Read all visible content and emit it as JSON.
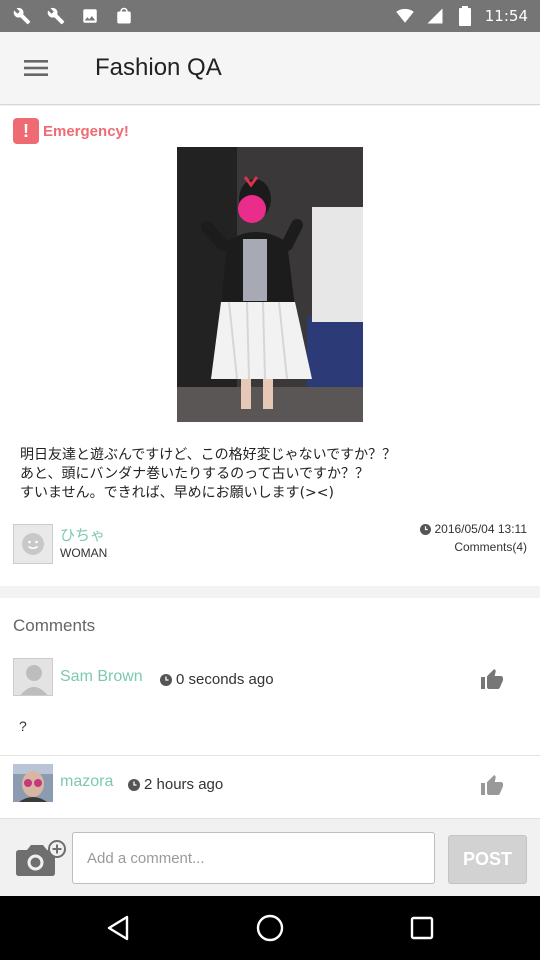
{
  "status_bar": {
    "time": "11:54",
    "icons": [
      "wrench-icon",
      "wrench-icon",
      "gallery-icon",
      "bag-icon",
      "wifi-icon",
      "signal-icon",
      "battery-icon"
    ]
  },
  "app_bar": {
    "title": "Fashion QA",
    "menu_icon": "hamburger-menu-icon"
  },
  "post": {
    "tag_badge": "!",
    "tag_label": "Emergency!",
    "text": "明日友達と遊ぶんですけど、この格好変じゃないですか？？\nあと、頭にバンダナ巻いたりするのって古いですか？？\nすいません。できれば、早めにお願いします(><)",
    "author_name": "ひちゃ",
    "author_gender": "WOMAN",
    "date": "2016/05/04 13:11",
    "comments_count": "Comments(4)"
  },
  "comments_section": {
    "header": "Comments",
    "items": [
      {
        "name": "Sam Brown",
        "time": "0 seconds ago",
        "text": "?"
      },
      {
        "name": "mazora",
        "time": "2 hours ago",
        "text": ""
      }
    ]
  },
  "input_bar": {
    "placeholder": "Add a comment...",
    "post_label": "POST"
  },
  "colors": {
    "accent_green": "#7ec8b0",
    "emergency_red": "#ee6b74",
    "status_bar": "#757575"
  }
}
